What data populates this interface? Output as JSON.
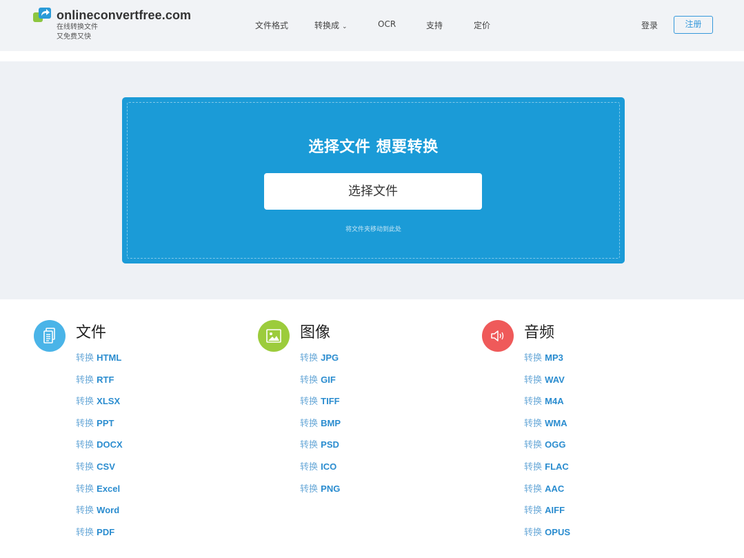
{
  "site": {
    "name": "onlineconvertfree.com",
    "tagline_line1": "在线转换文件",
    "tagline_line2": "又免费又快"
  },
  "nav": {
    "items": [
      {
        "label": "文件格式"
      },
      {
        "label": "转换成",
        "caret": "⌄"
      },
      {
        "label": "OCR"
      },
      {
        "label": "支持"
      },
      {
        "label": "定价"
      }
    ],
    "login": "登录",
    "register": "注册"
  },
  "hero": {
    "title": "选择文件 想要转换",
    "choose_button": "选择文件",
    "drag_hint": "将文件夹移动到此处"
  },
  "categories": [
    {
      "title": "文件",
      "icon": "document-icon",
      "color": "#4ab4e8",
      "prefix": "转换",
      "formats": [
        "HTML",
        "RTF",
        "XLSX",
        "PPT",
        "DOCX",
        "CSV",
        "Excel",
        "Word",
        "PDF"
      ]
    },
    {
      "title": "图像",
      "icon": "image-icon",
      "color": "#9ccc3c",
      "prefix": "转换",
      "formats": [
        "JPG",
        "GIF",
        "TIFF",
        "BMP",
        "PSD",
        "ICO",
        "PNG"
      ]
    },
    {
      "title": "音频",
      "icon": "speaker-icon",
      "color": "#ef5a5a",
      "prefix": "转换",
      "formats": [
        "MP3",
        "WAV",
        "M4A",
        "WMA",
        "OGG",
        "FLAC",
        "AAC",
        "AIFF",
        "OPUS"
      ]
    }
  ],
  "colors": {
    "accent": "#1b9bd7",
    "link": "#2a8ccf",
    "header_bg": "#f1f3f6"
  }
}
